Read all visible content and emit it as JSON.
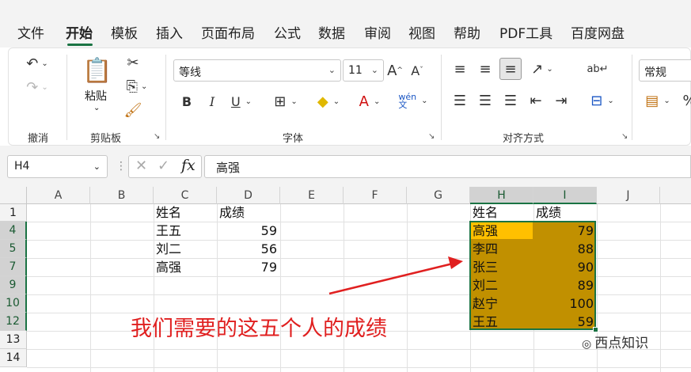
{
  "menu": {
    "tabs": [
      {
        "label": "文件"
      },
      {
        "label": "开始"
      },
      {
        "label": "模板"
      },
      {
        "label": "插入"
      },
      {
        "label": "页面布局"
      },
      {
        "label": "公式"
      },
      {
        "label": "数据"
      },
      {
        "label": "审阅"
      },
      {
        "label": "视图"
      },
      {
        "label": "帮助"
      },
      {
        "label": "PDF工具"
      },
      {
        "label": "百度网盘"
      }
    ],
    "active_tab": "开始",
    "accent_color": "#1a7343"
  },
  "ribbon": {
    "groups": {
      "undo": "撤消",
      "clipboard": "剪贴板",
      "font": "字体",
      "alignment": "对齐方式"
    },
    "paste_label": "粘贴",
    "font_name": "等线",
    "font_size": "11",
    "number_format": "常规",
    "pinyin_label": "wén\n文"
  },
  "formula_bar": {
    "name_box": "H4",
    "fx_symbol": "fx",
    "formula": "高强"
  },
  "sheet": {
    "columns": [
      "A",
      "B",
      "C",
      "D",
      "E",
      "F",
      "G",
      "H",
      "I",
      "J"
    ],
    "row_numbers": [
      "1",
      "4",
      "5",
      "7",
      "9",
      "10",
      "12",
      "13",
      "14"
    ],
    "left_table": {
      "header": [
        "姓名",
        "成绩"
      ],
      "rows": [
        [
          "王五",
          "59"
        ],
        [
          "刘二",
          "56"
        ],
        [
          "高强",
          "79"
        ]
      ]
    },
    "right_table": {
      "header": [
        "姓名",
        "成绩"
      ],
      "rows": [
        [
          "高强",
          "79"
        ],
        [
          "李四",
          "88"
        ],
        [
          "张三",
          "90"
        ],
        [
          "刘二",
          "89"
        ],
        [
          "赵宁",
          "100"
        ],
        [
          "王五",
          "59"
        ]
      ]
    },
    "selection_color": "#c19000",
    "active_cell_color": "#ffc000"
  },
  "annotation": {
    "text": "我们需要的这五个人的成绩",
    "color": "#e02020"
  },
  "watermark": {
    "text": "西点知识"
  }
}
